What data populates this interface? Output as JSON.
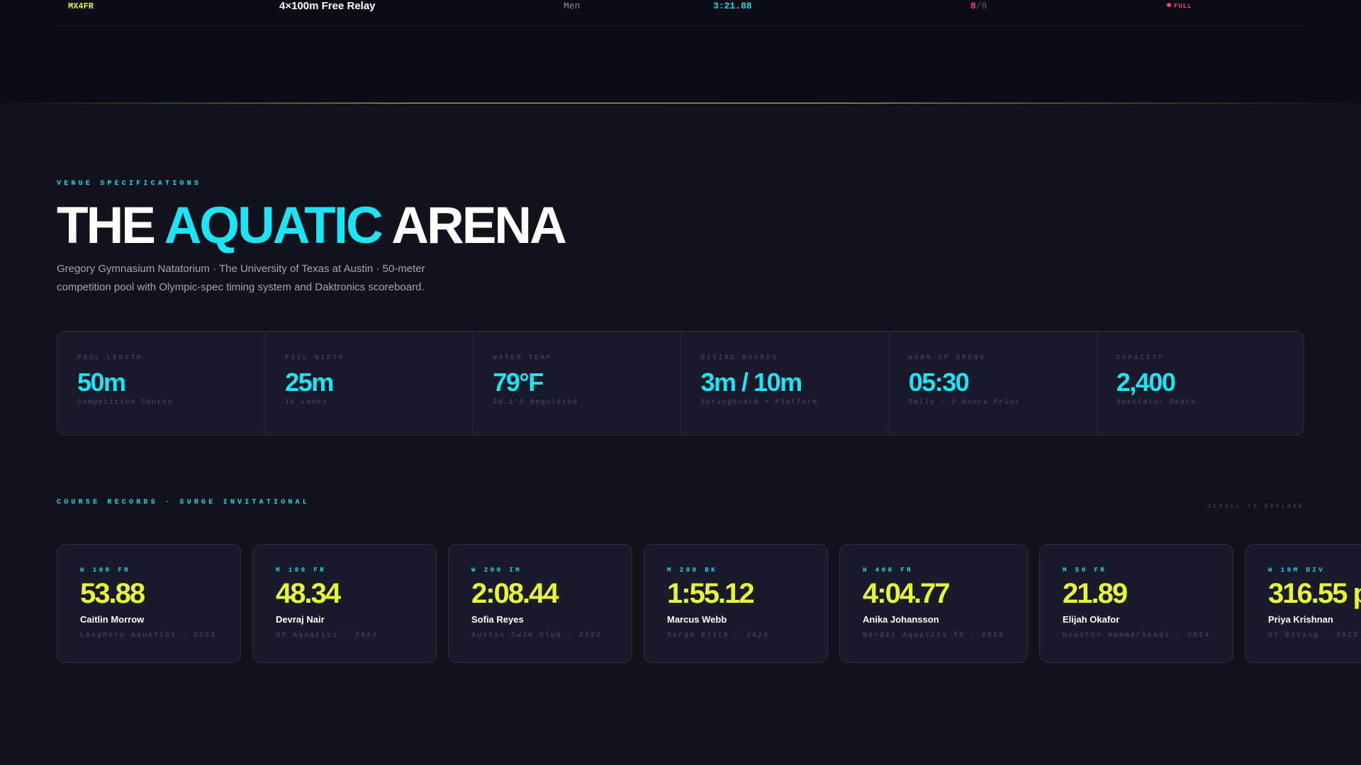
{
  "event_row": {
    "code": "MX4FR",
    "name": "4×100m Free Relay",
    "gender": "Men",
    "time": "3:21.88",
    "lanes_filled": "8",
    "lanes_total": "/8",
    "status": "FULL"
  },
  "venue": {
    "eyebrow": "VENUE SPECIFICATIONS",
    "title_part1": "THE ",
    "title_accent": "AQUATIC",
    "title_part2": " ARENA",
    "description": "Gregory Gymnasium Natatorium · The University of Texas at Austin · 50-meter competition pool with Olympic-spec timing system and Daktronics scoreboard."
  },
  "stats": [
    {
      "label": "POOL LENGTH",
      "value": "50m",
      "sub": "Competition Course"
    },
    {
      "label": "POOL WIDTH",
      "value": "25m",
      "sub": "10 Lanes"
    },
    {
      "label": "WATER TEMP",
      "value": "79°F",
      "sub": "26.1°C Regulated"
    },
    {
      "label": "DIVING BOARDS",
      "value": "3m / 10m",
      "sub": "Springboard + Platform"
    },
    {
      "label": "WARM-UP OPENS",
      "value": "05:30",
      "sub": "Daily · 2 Hours Prior"
    },
    {
      "label": "CAPACITY",
      "value": "2,400",
      "sub": "Spectator Seats"
    }
  ],
  "records": {
    "eyebrow": "COURSE RECORDS · SURGE INVITATIONAL",
    "scroll_hint": "— SCROLL TO EXPLORE",
    "items": [
      {
        "event": "W 100 FR",
        "time": "53.88",
        "name": "Caitlin Morrow",
        "club": "Longhorn Aquatics · 2023"
      },
      {
        "event": "M 100 FR",
        "time": "48.34",
        "name": "Devraj Nair",
        "club": "UT Aquatics · 2024"
      },
      {
        "event": "W 200 IM",
        "time": "2:08.44",
        "name": "Sofia Reyes",
        "club": "Austin Swim Club · 2022"
      },
      {
        "event": "M 200 BK",
        "time": "1:55.12",
        "name": "Marcus Webb",
        "club": "Surge Elite · 2024"
      },
      {
        "event": "W 400 FR",
        "time": "4:04.77",
        "name": "Anika Johansson",
        "club": "Nordic Aquatics TX · 2023"
      },
      {
        "event": "M 50 FR",
        "time": "21.89",
        "name": "Elijah Okafor",
        "club": "Houston Hammerheads · 2024"
      },
      {
        "event": "W 10M DIV",
        "time": "316.55 p",
        "name": "Priya Krishnan",
        "club": "UT Diving · 2023"
      }
    ]
  },
  "colors": {
    "background": "#10121c",
    "accent_cyan": "#1ee3f5",
    "accent_lime": "#e6f53c",
    "accent_pink": "#ff3d7f"
  }
}
